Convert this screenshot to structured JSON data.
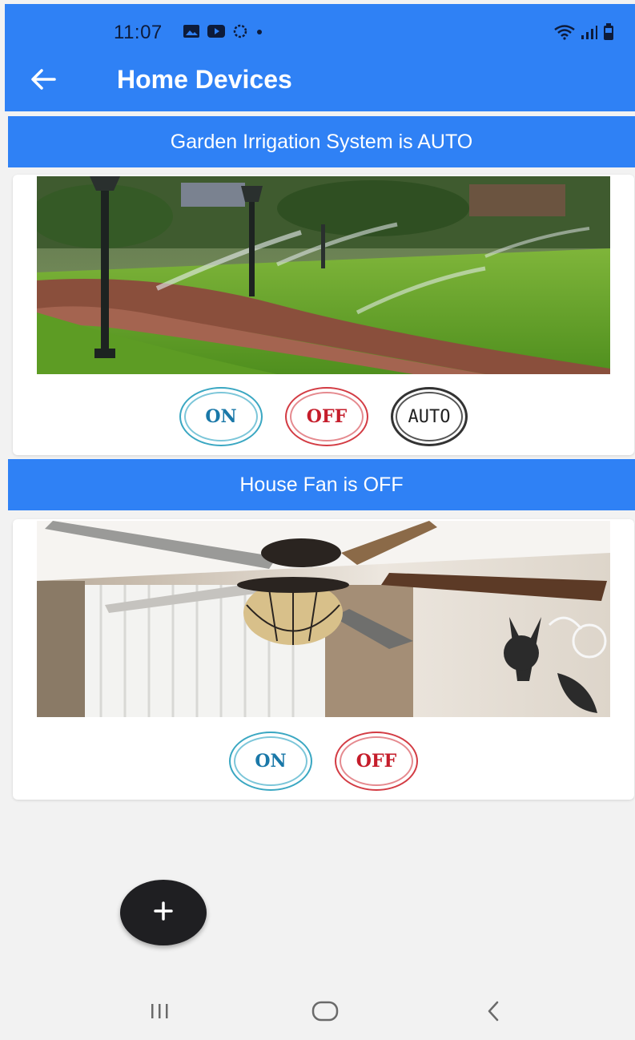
{
  "status_bar": {
    "time": "11:07",
    "left_icons": [
      "gallery-icon",
      "youtube-icon",
      "circle-icon",
      "dot-icon"
    ],
    "right_icons": [
      "wifi-icon",
      "signal-icon",
      "battery-icon"
    ]
  },
  "app_bar": {
    "title": "Home Devices",
    "back_icon": "arrow-left-icon"
  },
  "devices": [
    {
      "status_text": "Garden Irrigation System is AUTO",
      "image": "garden-sprinkler-image",
      "buttons": [
        "ON",
        "OFF",
        "AUTO"
      ]
    },
    {
      "status_text": "House Fan is OFF",
      "image": "ceiling-fan-image",
      "buttons": [
        "ON",
        "OFF"
      ]
    }
  ],
  "fab": {
    "label": "+",
    "icon": "plus-icon"
  },
  "nav_bar": {
    "items": [
      "recent-apps-icon",
      "home-icon",
      "back-icon"
    ]
  },
  "colors": {
    "primary": "#2f81f5",
    "on": "#1a78a8",
    "off": "#c51d2b",
    "auto": "#222222",
    "fab": "#1f1f22",
    "background": "#f2f2f2"
  }
}
